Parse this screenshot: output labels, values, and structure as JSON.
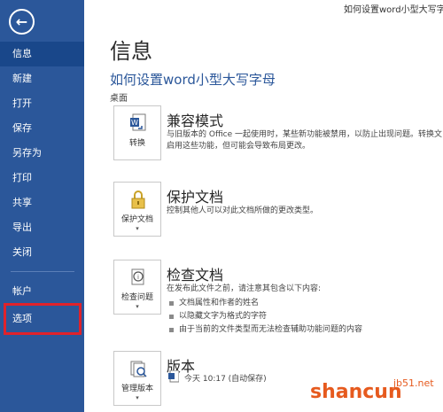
{
  "caption": "如何设置word小型大写字母",
  "sidebar": {
    "back": "←",
    "items": [
      {
        "label": "信息"
      },
      {
        "label": "新建"
      },
      {
        "label": "打开"
      },
      {
        "label": "保存"
      },
      {
        "label": "另存为"
      },
      {
        "label": "打印"
      },
      {
        "label": "共享"
      },
      {
        "label": "导出"
      },
      {
        "label": "关闭"
      },
      {
        "label": "帐户"
      },
      {
        "label": "选项"
      }
    ]
  },
  "main": {
    "title": "信息",
    "doc_name": "如何设置word小型大写字母",
    "doc_location": "桌面",
    "sections": [
      {
        "tile_label": "转换",
        "title": "兼容模式",
        "desc": "与旧版本的 Office 一起使用时，某些新功能被禁用，以防止出现问题。转换文\n启用这些功能，但可能会导致布局更改。"
      },
      {
        "tile_label": "保护文档",
        "title": "保护文档",
        "desc": "控制其他人可以对此文档所做的更改类型。"
      },
      {
        "tile_label": "检查问题",
        "title": "检查文档",
        "desc": "在发布此文件之前，请注意其包含以下内容:",
        "bullets": [
          "文档属性和作者的姓名",
          "以隐藏文字为格式的字符",
          "由于当前的文件类型而无法检查辅助功能问题的内容"
        ]
      },
      {
        "tile_label": "管理版本",
        "title": "版本",
        "version_entry": "今天 10:17 (自动保存)"
      }
    ]
  },
  "watermark": {
    "text": "shancun",
    "sub": "jb51.net"
  },
  "colors": {
    "sidebar": "#2b579a",
    "accent": "#2b579a",
    "highlight": "#e0222b",
    "watermark": "#e65a1e"
  }
}
